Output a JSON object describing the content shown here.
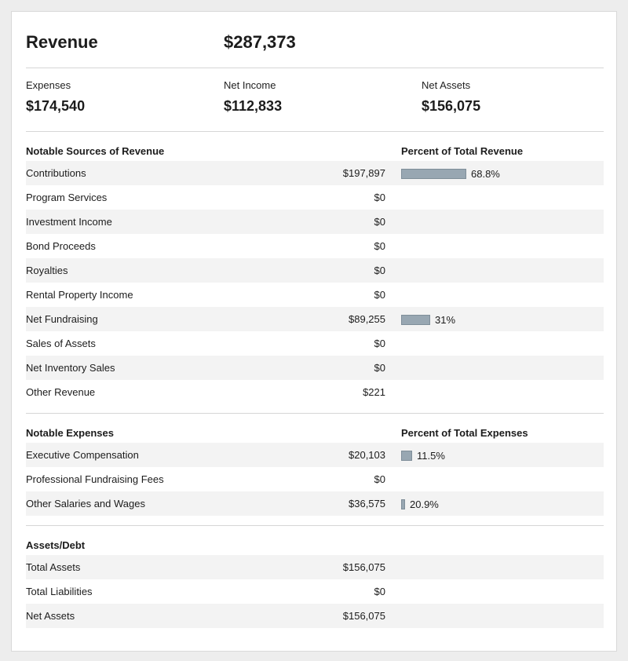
{
  "colors": {
    "bar": "#98a7b2",
    "row_shade": "#f3f3f3",
    "divider": "#d6d6d6"
  },
  "revenue": {
    "label": "Revenue",
    "value": "$287,373"
  },
  "summary": [
    {
      "label": "Expenses",
      "value": "$174,540"
    },
    {
      "label": "Net Income",
      "value": "$112,833"
    },
    {
      "label": "Net Assets",
      "value": "$156,075"
    }
  ],
  "revenue_sources": {
    "title": "Notable Sources of Revenue",
    "pct_title": "Percent of Total Revenue",
    "rows": [
      {
        "name": "Contributions",
        "amount": "$197,897",
        "percent": 68.8,
        "percent_label": "68.8%"
      },
      {
        "name": "Program Services",
        "amount": "$0"
      },
      {
        "name": "Investment Income",
        "amount": "$0"
      },
      {
        "name": "Bond Proceeds",
        "amount": "$0"
      },
      {
        "name": "Royalties",
        "amount": "$0"
      },
      {
        "name": "Rental Property Income",
        "amount": "$0"
      },
      {
        "name": "Net Fundraising",
        "amount": "$89,255",
        "percent": 31,
        "percent_label": "31%"
      },
      {
        "name": "Sales of Assets",
        "amount": "$0"
      },
      {
        "name": "Net Inventory Sales",
        "amount": "$0"
      },
      {
        "name": "Other Revenue",
        "amount": "$221"
      }
    ]
  },
  "expenses": {
    "title": "Notable Expenses",
    "pct_title": "Percent of Total Expenses",
    "rows": [
      {
        "name": "Executive Compensation",
        "amount": "$20,103",
        "percent": 11.5,
        "percent_label": "11.5%"
      },
      {
        "name": "Professional Fundraising Fees",
        "amount": "$0"
      },
      {
        "name": "Other Salaries and Wages",
        "amount": "$36,575",
        "percent": 20.9,
        "percent_label": "20.9%"
      }
    ]
  },
  "assets": {
    "title": "Assets/Debt",
    "rows": [
      {
        "name": "Total Assets",
        "amount": "$156,075"
      },
      {
        "name": "Total Liabilities",
        "amount": "$0"
      },
      {
        "name": "Net Assets",
        "amount": "$156,075"
      }
    ]
  }
}
